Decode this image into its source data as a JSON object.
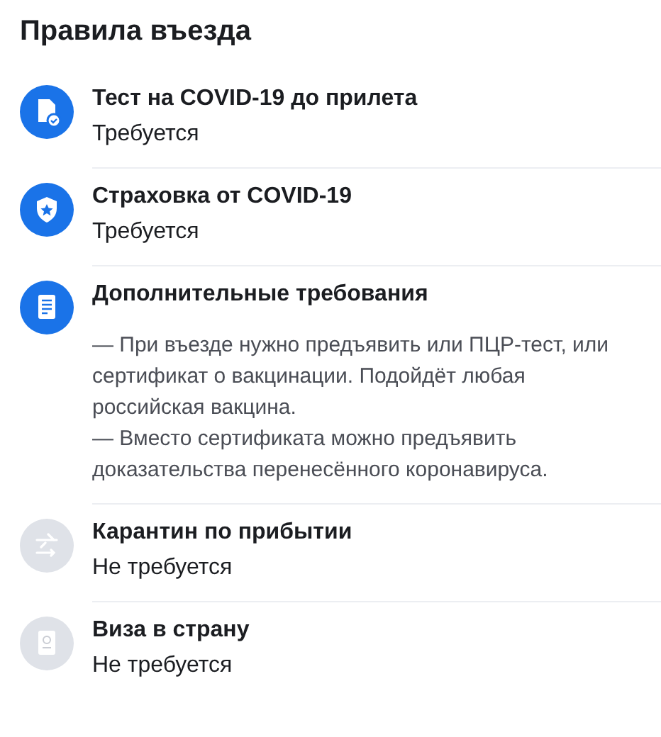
{
  "title": "Правила въезда",
  "rules": [
    {
      "kind": "test",
      "active": true,
      "name": "Тест на COVID-19 до прилета",
      "status": "Требуется"
    },
    {
      "kind": "insurance",
      "active": true,
      "name": "Страховка от COVID-19",
      "status": "Требуется"
    },
    {
      "kind": "document",
      "active": true,
      "name": "Дополнительные требования",
      "notes": [
        "— При въезде нужно предъявить или ПЦР-тест, или сертификат о вакцинации. Подойдёт любая российская вакцина.",
        "— Вместо сертификата можно предъявить доказательства перенесённого коронавируса."
      ]
    },
    {
      "kind": "quarantine",
      "active": false,
      "name": "Карантин по прибытии",
      "status": "Не требуется"
    },
    {
      "kind": "visa",
      "active": false,
      "name": "Виза в страну",
      "status": "Не требуется"
    }
  ]
}
